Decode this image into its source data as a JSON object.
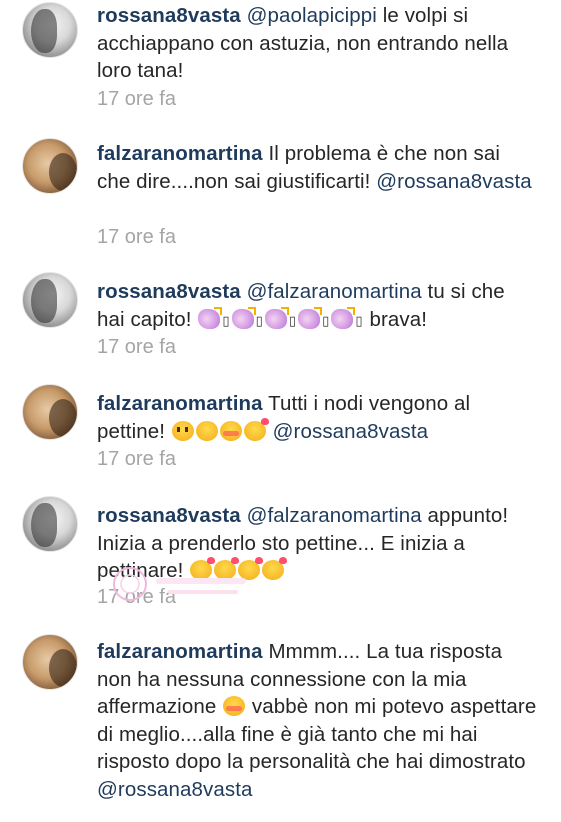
{
  "comments": [
    {
      "user": "rossana8vasta",
      "mention": "@paolapicippi",
      "text": " le volpi si acchiappano con astuzia, non entrando nella loro tana!",
      "time": "17 ore fa",
      "avatar": "avatar-rossana8vasta"
    },
    {
      "user": "falzaranomartina",
      "text": " Il problema è che non sai che dire....non sai giustificarti!",
      "mention_end": "@rossana8vasta",
      "time": "17 ore fa",
      "avatar": "avatar-falzaranomartina"
    },
    {
      "user": "rossana8vasta",
      "mention": "@falzaranomartina",
      "text_before": " tu si che hai capito!",
      "box_glyph": "▯",
      "text_after": " brava!",
      "time": "17 ore fa",
      "avatar": "avatar-rossana8vasta"
    },
    {
      "user": "falzaranomartina",
      "text": " Tutti i nodi vengono al pettine!",
      "mention_end": "@rossana8vasta",
      "time": "17 ore fa",
      "avatar": "avatar-falzaranomartina"
    },
    {
      "user": "rossana8vasta",
      "mention": "@falzaranomartina",
      "text": " appunto! Inizia a prenderlo sto pettine... E inizia a pettinare!",
      "time": "17 ore fa",
      "avatar": "avatar-rossana8vasta"
    },
    {
      "user": "falzaranomartina",
      "text_before": " Mmmm.... La tua risposta non ha nessuna connessione con la mia affermazione",
      "text_after": " vabbè non mi potevo aspettare di meglio....alla fine è già tanto che mi hai risposto dopo la personalità che hai dimostrato",
      "mention_end": "@rossana8vasta",
      "avatar": "avatar-falzaranomartina"
    }
  ],
  "icons": {
    "clap": "clapping-hands-sparkle-icon",
    "kiss": "kissing-face-icon",
    "flushed": "flushed-face-icon"
  },
  "colors": {
    "username": "#1f3b5c",
    "timestamp": "#a5a5a5",
    "text": "#262626"
  }
}
